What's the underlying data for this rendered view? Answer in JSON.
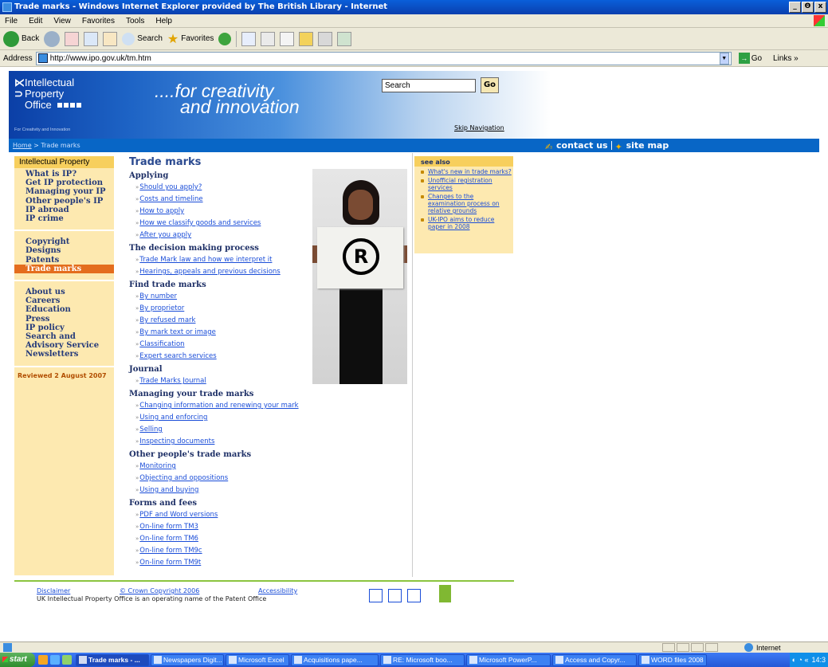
{
  "window": {
    "title": "Trade marks - Windows Internet Explorer provided by The British Library - Internet",
    "controls": [
      "_",
      "Θ",
      "x"
    ]
  },
  "menu": [
    "File",
    "Edit",
    "View",
    "Favorites",
    "Tools",
    "Help"
  ],
  "toolbar": {
    "back": "Back",
    "search": "Search",
    "favorites": "Favorites"
  },
  "address": {
    "label": "Address",
    "url": "http://www.ipo.gov.uk/tm.htm",
    "go": "Go",
    "links": "Links"
  },
  "site": {
    "logo": [
      "Intellectual",
      "Property",
      "Office"
    ],
    "logo_tag": "For Creativity and Innovation",
    "tagline_1": "....for creativity",
    "tagline_2": "and innovation",
    "search_value": "Search",
    "go": "Go",
    "skip": "Skip Navigation"
  },
  "breadcrumb": {
    "home": "Home",
    "sep": " > ",
    "current": "Trade marks"
  },
  "toplinks": {
    "contact": "contact us",
    "sitemap": "site map"
  },
  "leftnav": {
    "header": "Intellectual Property",
    "group1": [
      "What is IP?",
      "Get IP protection",
      "Managing your IP",
      "Other people's IP",
      "IP abroad",
      "IP crime"
    ],
    "group2": [
      "Copyright",
      "Designs",
      "Patents",
      "Trade marks"
    ],
    "group3": [
      "About us",
      "Careers",
      "Education",
      "Press",
      "IP policy",
      "Search and Advisory Service",
      "Newsletters"
    ],
    "reviewed": "Reviewed 2 August 2007"
  },
  "main": {
    "title": "Trade marks",
    "sections": [
      {
        "heading": "Applying",
        "links": [
          "Should you apply?",
          "Costs and timeline",
          "How to apply",
          "How we classify goods and services",
          "After you apply"
        ]
      },
      {
        "heading": "The decision making process",
        "links": [
          "Trade Mark law and how we interpret it",
          "Hearings, appeals and previous decisions"
        ]
      },
      {
        "heading": "Find trade marks",
        "links": [
          "By number",
          "By proprietor",
          "By refused mark",
          "By mark text or image",
          "Classification",
          "Expert search services"
        ]
      },
      {
        "heading": "Journal",
        "links": [
          "Trade Marks Journal"
        ]
      },
      {
        "heading": "Managing your trade marks",
        "links": [
          "Changing information and renewing your mark",
          "Using and enforcing",
          "Selling",
          "Inspecting documents"
        ]
      },
      {
        "heading": "Other people's trade marks",
        "links": [
          "Monitoring",
          "Objecting and oppositions",
          "Using and buying"
        ]
      },
      {
        "heading": "Forms and fees",
        "links": [
          "PDF and Word versions",
          "On-line form TM3",
          "On-line form TM6",
          "On-line form TM9c",
          "On-line form TM9t"
        ]
      }
    ]
  },
  "photo": {
    "symbol": "R"
  },
  "seealso": {
    "header": "see also",
    "items": [
      "What's new in trade marks?",
      "Unofficial registration services",
      "Changes to the examination process on relative grounds",
      "UK-IPO aims to reduce paper in 2008"
    ]
  },
  "footer": {
    "disclaimer": "Disclaimer",
    "copyright": "© Crown Copyright 2006",
    "accessibility": "Accessibility",
    "note": "UK Intellectual Property Office is an operating name of the Patent Office"
  },
  "status": {
    "zone": "Internet"
  },
  "taskbar": {
    "start": "start",
    "tasks": [
      "Trade marks - ...",
      "Newspapers Digit...",
      "Microsoft Excel",
      "Acquisitions pape...",
      "RE: Microsoft boo...",
      "Microsoft PowerP...",
      "Access and Copyr...",
      "WORD files 2008"
    ],
    "clock": "14:3"
  }
}
